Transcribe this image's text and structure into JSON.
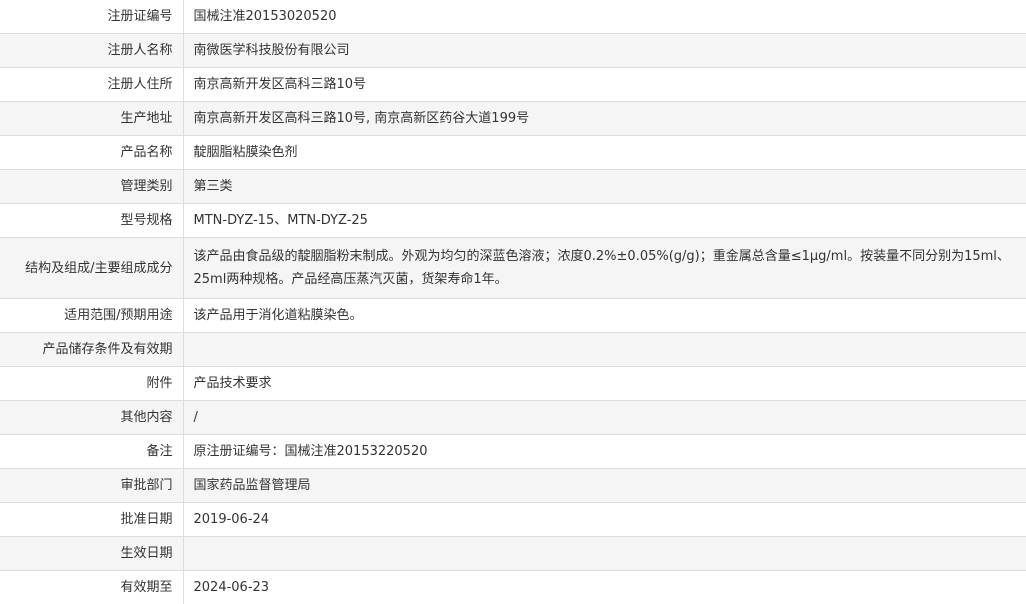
{
  "rows": [
    {
      "label": "注册证编号",
      "value": "国械注准20153020520"
    },
    {
      "label": "注册人名称",
      "value": "南微医学科技股份有限公司"
    },
    {
      "label": "注册人住所",
      "value": "南京高新开发区高科三路10号"
    },
    {
      "label": "生产地址",
      "value": "南京高新开发区高科三路10号, 南京高新区药谷大道199号"
    },
    {
      "label": "产品名称",
      "value": "靛胭脂粘膜染色剂"
    },
    {
      "label": "管理类别",
      "value": "第三类"
    },
    {
      "label": "型号规格",
      "value": "MTN-DYZ-15、MTN-DYZ-25"
    },
    {
      "label": "结构及组成/主要组成成分",
      "value": "该产品由食品级的靛胭脂粉末制成。外观为均匀的深蓝色溶液；浓度0.2%±0.05%(g/g)；重金属总含量≤1μg/ml。按装量不同分别为15ml、25ml两种规格。产品经高压蒸汽灭菌，货架寿命1年。"
    },
    {
      "label": "适用范围/预期用途",
      "value": "该产品用于消化道粘膜染色。"
    },
    {
      "label": "产品储存条件及有效期",
      "value": ""
    },
    {
      "label": "附件",
      "value": "产品技术要求"
    },
    {
      "label": "其他内容",
      "value": "/"
    },
    {
      "label": "备注",
      "value": "原注册证编号：国械注准20153220520"
    },
    {
      "label": "审批部门",
      "value": "国家药品监督管理局"
    },
    {
      "label": "批准日期",
      "value": "2019-06-24"
    },
    {
      "label": "生效日期",
      "value": ""
    },
    {
      "label": "有效期至",
      "value": "2024-06-23"
    }
  ]
}
